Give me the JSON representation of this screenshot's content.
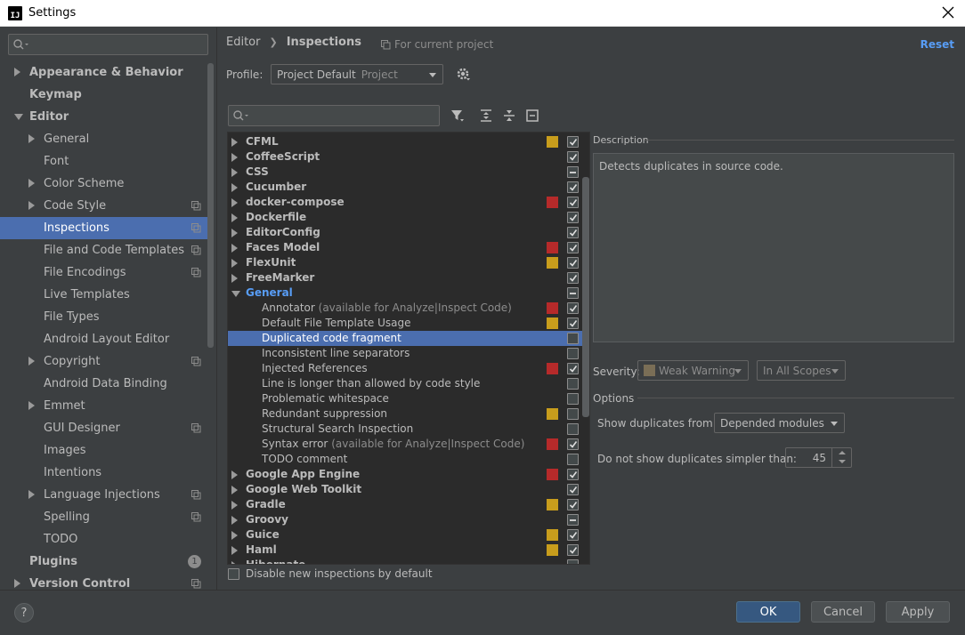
{
  "window": {
    "title": "Settings",
    "app_icon_text": "IJ"
  },
  "left_tree": {
    "items": [
      {
        "label": "Appearance & Behavior",
        "level": 0,
        "bold": true,
        "arrow": "right"
      },
      {
        "label": "Keymap",
        "level": 0,
        "bold": true,
        "arrow": "none"
      },
      {
        "label": "Editor",
        "level": 0,
        "bold": true,
        "arrow": "down"
      },
      {
        "label": "General",
        "level": 1,
        "arrow": "right"
      },
      {
        "label": "Font",
        "level": 1,
        "arrow": "none"
      },
      {
        "label": "Color Scheme",
        "level": 1,
        "arrow": "right"
      },
      {
        "label": "Code Style",
        "level": 1,
        "arrow": "right",
        "copy": true
      },
      {
        "label": "Inspections",
        "level": 1,
        "arrow": "none",
        "copy": true,
        "selected": true
      },
      {
        "label": "File and Code Templates",
        "level": 1,
        "arrow": "none",
        "copy": true
      },
      {
        "label": "File Encodings",
        "level": 1,
        "arrow": "none",
        "copy": true
      },
      {
        "label": "Live Templates",
        "level": 1,
        "arrow": "none"
      },
      {
        "label": "File Types",
        "level": 1,
        "arrow": "none"
      },
      {
        "label": "Android Layout Editor",
        "level": 1,
        "arrow": "none"
      },
      {
        "label": "Copyright",
        "level": 1,
        "arrow": "right",
        "copy": true
      },
      {
        "label": "Android Data Binding",
        "level": 1,
        "arrow": "none"
      },
      {
        "label": "Emmet",
        "level": 1,
        "arrow": "right"
      },
      {
        "label": "GUI Designer",
        "level": 1,
        "arrow": "none",
        "copy": true
      },
      {
        "label": "Images",
        "level": 1,
        "arrow": "none"
      },
      {
        "label": "Intentions",
        "level": 1,
        "arrow": "none"
      },
      {
        "label": "Language Injections",
        "level": 1,
        "arrow": "right",
        "copy": true
      },
      {
        "label": "Spelling",
        "level": 1,
        "arrow": "none",
        "copy": true
      },
      {
        "label": "TODO",
        "level": 1,
        "arrow": "none"
      },
      {
        "label": "Plugins",
        "level": 0,
        "bold": true,
        "arrow": "none",
        "badge": "1"
      },
      {
        "label": "Version Control",
        "level": 0,
        "bold": true,
        "arrow": "right",
        "copy": true
      }
    ]
  },
  "breadcrumb": {
    "parent": "Editor",
    "current": "Inspections",
    "scope_note": "For current project"
  },
  "reset_label": "Reset",
  "profile": {
    "label": "Profile:",
    "value": "Project Default",
    "hint": "Project"
  },
  "inspections": [
    {
      "label": "CFML",
      "group": true,
      "arrow": "right",
      "sev": "yellow",
      "check": "checked"
    },
    {
      "label": "CoffeeScript",
      "group": true,
      "arrow": "right",
      "sev": "",
      "check": "checked"
    },
    {
      "label": "CSS",
      "group": true,
      "arrow": "right",
      "sev": "",
      "check": "partial"
    },
    {
      "label": "Cucumber",
      "group": true,
      "arrow": "right",
      "sev": "",
      "check": "checked"
    },
    {
      "label": "docker-compose",
      "group": true,
      "arrow": "right",
      "sev": "red",
      "check": "checked"
    },
    {
      "label": "Dockerfile",
      "group": true,
      "arrow": "right",
      "sev": "",
      "check": "checked"
    },
    {
      "label": "EditorConfig",
      "group": true,
      "arrow": "right",
      "sev": "",
      "check": "checked"
    },
    {
      "label": "Faces Model",
      "group": true,
      "arrow": "right",
      "sev": "red",
      "check": "checked"
    },
    {
      "label": "FlexUnit",
      "group": true,
      "arrow": "right",
      "sev": "yellow",
      "check": "checked"
    },
    {
      "label": "FreeMarker",
      "group": true,
      "arrow": "right",
      "sev": "",
      "check": "checked"
    },
    {
      "label": "General",
      "group": true,
      "arrow": "down",
      "blue": true,
      "sev": "",
      "check": "partial"
    },
    {
      "label": "Annotator",
      "hint": "(available for Analyze|Inspect Code)",
      "sev": "red",
      "check": "checked"
    },
    {
      "label": "Default File Template Usage",
      "sev": "yellow",
      "check": "checked"
    },
    {
      "label": "Duplicated code fragment",
      "sev": "",
      "check": "empty",
      "selected": true
    },
    {
      "label": "Inconsistent line separators",
      "sev": "",
      "check": "empty"
    },
    {
      "label": "Injected References",
      "sev": "red",
      "check": "checked"
    },
    {
      "label": "Line is longer than allowed by code style",
      "sev": "",
      "check": "empty"
    },
    {
      "label": "Problematic whitespace",
      "sev": "",
      "check": "empty"
    },
    {
      "label": "Redundant suppression",
      "sev": "yellow",
      "check": "empty"
    },
    {
      "label": "Structural Search Inspection",
      "sev": "",
      "check": "empty"
    },
    {
      "label": "Syntax error",
      "hint": "(available for Analyze|Inspect Code)",
      "sev": "red",
      "check": "checked"
    },
    {
      "label": "TODO comment",
      "sev": "",
      "check": "empty"
    },
    {
      "label": "Google App Engine",
      "group": true,
      "arrow": "right",
      "sev": "red",
      "check": "checked"
    },
    {
      "label": "Google Web Toolkit",
      "group": true,
      "arrow": "right",
      "sev": "",
      "check": "checked"
    },
    {
      "label": "Gradle",
      "group": true,
      "arrow": "right",
      "sev": "yellow",
      "check": "checked"
    },
    {
      "label": "Groovy",
      "group": true,
      "arrow": "right",
      "sev": "",
      "check": "partial"
    },
    {
      "label": "Guice",
      "group": true,
      "arrow": "right",
      "sev": "yellow",
      "check": "checked"
    },
    {
      "label": "Haml",
      "group": true,
      "arrow": "right",
      "sev": "yellow",
      "check": "checked"
    },
    {
      "label": "Hibernate",
      "group": true,
      "arrow": "right",
      "sev": "",
      "check": "partial"
    }
  ],
  "disable_new_label": "Disable new inspections by default",
  "description": {
    "title": "Description",
    "text": "Detects duplicates in source code."
  },
  "severity": {
    "label": "Severity:",
    "value": "Weak Warning",
    "scope": "In All Scopes"
  },
  "options": {
    "title": "Options",
    "show_from_label": "Show duplicates from",
    "show_from_value": "Depended modules",
    "simpler_label": "Do not show duplicates simpler than:",
    "simpler_value": "45"
  },
  "buttons": {
    "help": "?",
    "ok": "OK",
    "cancel": "Cancel",
    "apply": "Apply"
  },
  "colors": {
    "accent": "#4b6eaf",
    "link": "#589df6",
    "sev_red": "#b62a2a",
    "sev_yellow": "#c89d1c"
  }
}
